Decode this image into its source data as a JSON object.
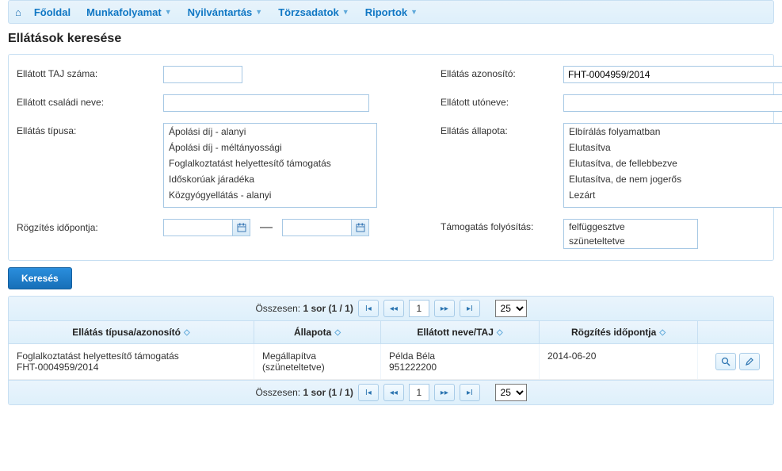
{
  "nav": {
    "home_icon": "⌂",
    "items": [
      {
        "label": "Főoldal",
        "dropdown": false
      },
      {
        "label": "Munkafolyamat",
        "dropdown": true
      },
      {
        "label": "Nyilvántartás",
        "dropdown": true
      },
      {
        "label": "Törzsadatok",
        "dropdown": true
      },
      {
        "label": "Riportok",
        "dropdown": true
      }
    ]
  },
  "title": "Ellátások keresése",
  "form": {
    "taj": {
      "label": "Ellátott TAJ száma:",
      "value": ""
    },
    "azon": {
      "label": "Ellátás azonosító:",
      "value": "FHT-0004959/2014"
    },
    "csaladi": {
      "label": "Ellátott családi neve:",
      "value": ""
    },
    "utoneve": {
      "label": "Ellátott utóneve:",
      "value": ""
    },
    "tipus": {
      "label": "Ellátás típusa:",
      "options": [
        "Ápolási díj - alanyi",
        "Ápolási díj - méltányossági",
        "Foglalkoztatást helyettesítő támogatás",
        "Időskorúak járadéka",
        "Közgyógyellátás - alanyi"
      ]
    },
    "allapota": {
      "label": "Ellátás állapota:",
      "options": [
        "Elbírálás folyamatban",
        "Elutasítva",
        "Elutasítva, de fellebbezve",
        "Elutasítva, de nem jogerős",
        "Lezárt"
      ]
    },
    "rogz": {
      "label": "Rögzítés időpontja:",
      "from": "",
      "to": "",
      "sep": "—"
    },
    "folyositas": {
      "label": "Támogatás folyósítás:",
      "options": [
        "felfüggesztve",
        "szüneteltetve"
      ]
    },
    "search_label": "Keresés"
  },
  "pager": {
    "summary_prefix": "Összesen: ",
    "summary_rows": "1 sor",
    "summary_pages": " (1 / 1)",
    "page": "1",
    "page_size": "25"
  },
  "table": {
    "headers": {
      "col1": "Ellátás típusa/azonosító",
      "col2": "Állapota",
      "col3": "Ellátott neve/TAJ",
      "col4": "Rögzítés időpontja"
    },
    "row": {
      "tipus_line1": "Foglalkoztatást helyettesítő támogatás",
      "tipus_line2": "FHT-0004959/2014",
      "allapot_line1": "Megállapítva",
      "allapot_line2": "(szüneteltetve)",
      "nev_line1": "Példa Béla",
      "nev_line2": "951222200",
      "date": "2014-06-20"
    }
  }
}
